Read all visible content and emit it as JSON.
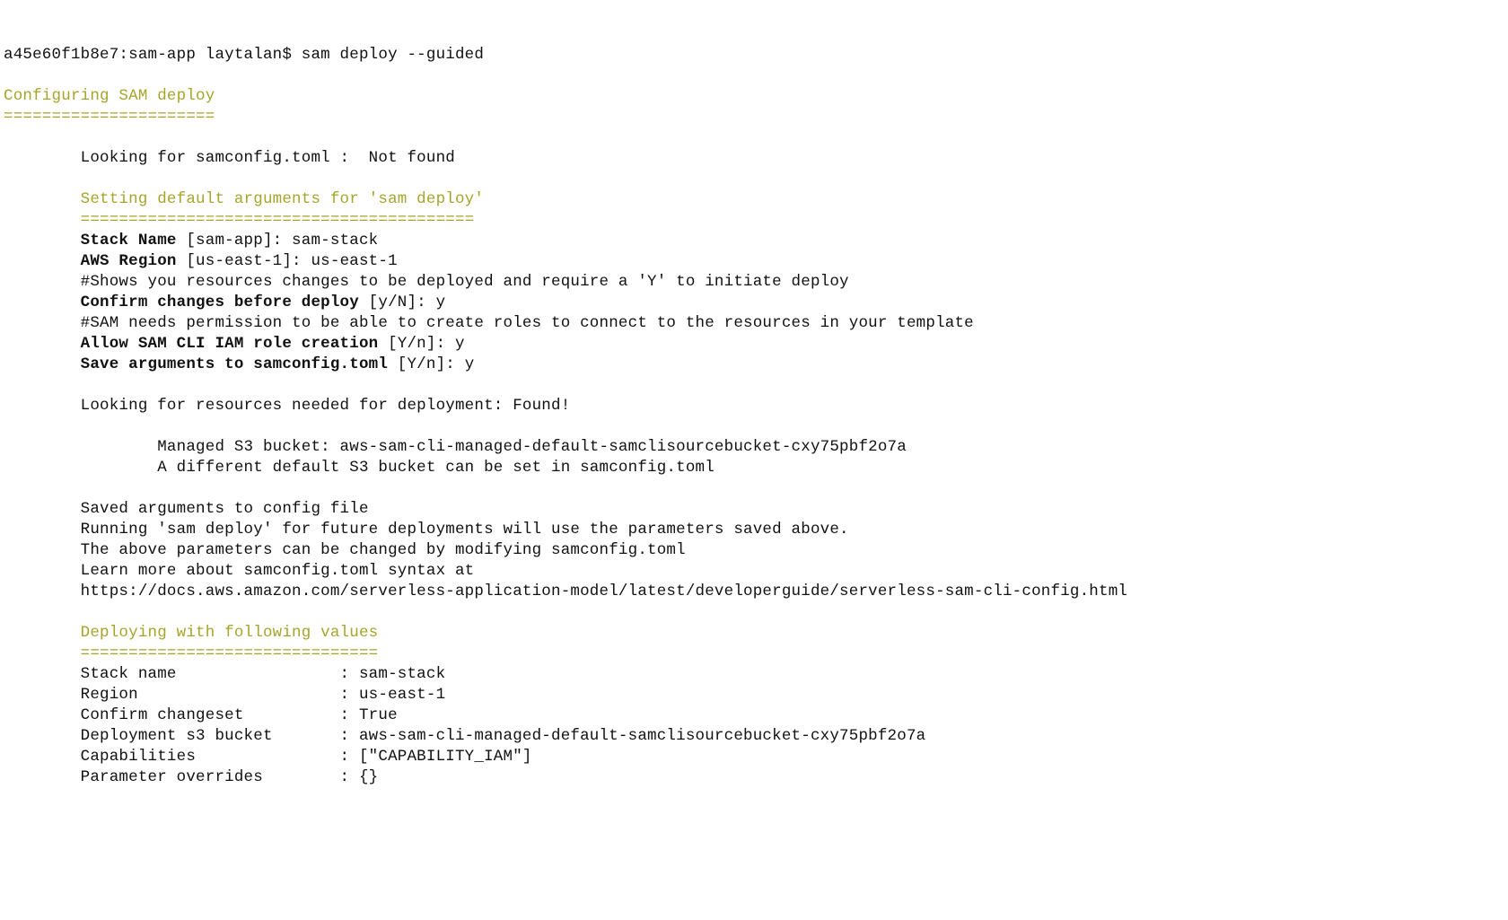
{
  "prompt": "a45e60f1b8e7:sam-app laytalan$ sam deploy --guided",
  "header": {
    "title": "Configuring SAM deploy",
    "rule": "======================"
  },
  "looking_config": "        Looking for samconfig.toml :  Not found",
  "defaults": {
    "title": "        Setting default arguments for 'sam deploy'",
    "rule": "        =========================================",
    "stack_name_label": "        Stack Name",
    "stack_name_rest": " [sam-app]: sam-stack",
    "region_label": "        AWS Region",
    "region_rest": " [us-east-1]: us-east-1",
    "confirm_comment": "        #Shows you resources changes to be deployed and require a 'Y' to initiate deploy",
    "confirm_label": "        Confirm changes before deploy",
    "confirm_rest": " [y/N]: y",
    "iam_comment": "        #SAM needs permission to be able to create roles to connect to the resources in your template",
    "iam_label": "        Allow SAM CLI IAM role creation",
    "iam_rest": " [Y/n]: y",
    "save_label": "        Save arguments to samconfig.toml",
    "save_rest": " [Y/n]: y"
  },
  "resources": {
    "looking": "        Looking for resources needed for deployment: Found!",
    "bucket": "                Managed S3 bucket: aws-sam-cli-managed-default-samclisourcebucket-cxy75pbf2o7a",
    "alt": "                A different default S3 bucket can be set in samconfig.toml"
  },
  "saved": {
    "l1": "        Saved arguments to config file",
    "l2": "        Running 'sam deploy' for future deployments will use the parameters saved above.",
    "l3": "        The above parameters can be changed by modifying samconfig.toml",
    "l4": "        Learn more about samconfig.toml syntax at",
    "l5": "        https://docs.aws.amazon.com/serverless-application-model/latest/developerguide/serverless-sam-cli-config.html"
  },
  "deploy": {
    "title": "        Deploying with following values",
    "rule": "        ===============================",
    "stack": "        Stack name                 : sam-stack",
    "region": "        Region                     : us-east-1",
    "confirm": "        Confirm changeset          : True",
    "bucket": "        Deployment s3 bucket       : aws-sam-cli-managed-default-samclisourcebucket-cxy75pbf2o7a",
    "caps": "        Capabilities               : [\"CAPABILITY_IAM\"]",
    "params": "        Parameter overrides        : {}"
  }
}
